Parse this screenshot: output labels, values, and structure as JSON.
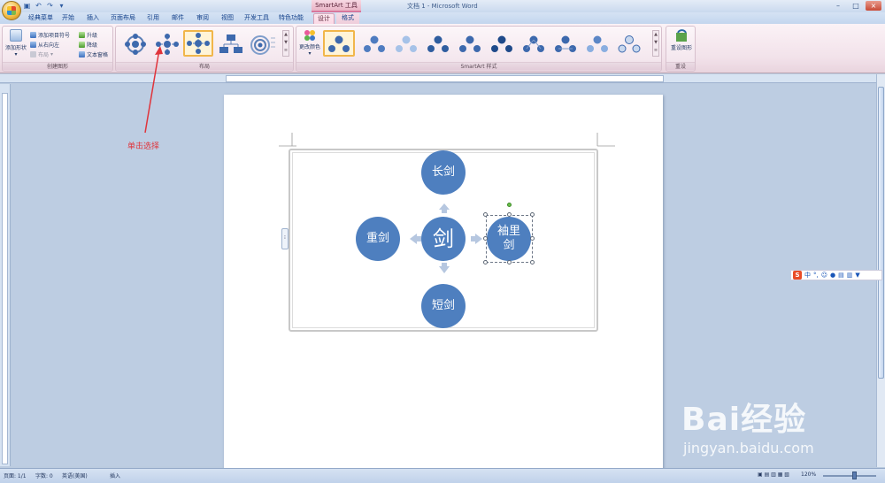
{
  "window": {
    "context_title": "SmartArt 工具",
    "doc_title": "文档 1 - Microsoft Word",
    "controls": [
      "–",
      "□",
      "×"
    ]
  },
  "tabs": [
    "经典菜单",
    "开始",
    "插入",
    "页面布局",
    "引用",
    "邮件",
    "审阅",
    "视图",
    "开发工具",
    "特色功能",
    "设计",
    "格式"
  ],
  "active_tab": "设计",
  "ribbon": {
    "create_graphic": {
      "label": "创建图形",
      "add_shape": "添加形状",
      "add_bullet": "添加项目符号",
      "right_to_left": "从右向左",
      "layout": "布局",
      "promote": "升级",
      "demote": "降级",
      "text_pane": "文本窗格"
    },
    "layouts": {
      "label": "布局",
      "selected_index": 2
    },
    "smartart_styles": {
      "label": "SmartArt 样式",
      "change_colors": "更改颜色"
    },
    "reset": {
      "label": "重设",
      "reset_graphic": "重设图形"
    }
  },
  "annotation": "单击选择",
  "diagram": {
    "center": "剑",
    "top": "长剑",
    "left": "重剑",
    "bottom": "短剑",
    "right": "袖里剑"
  },
  "ime": {
    "logo": "S",
    "mode": "中"
  },
  "watermark": {
    "brand": "Bai经验",
    "url": "jingyan.baidu.com"
  },
  "status": {
    "page": "页面: 1/1",
    "words": "字数: 0",
    "language": "英语(美国)",
    "insert_mode": "插入",
    "zoom": "120%"
  },
  "colors": {
    "node": "#4e7fbf",
    "annotation": "#e0343b",
    "ribbon_ctx": "#fbd9e6"
  }
}
